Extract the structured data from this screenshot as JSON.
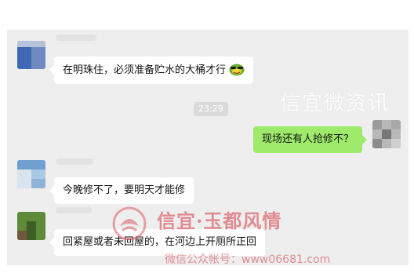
{
  "chat": {
    "messages": [
      {
        "side": "left",
        "text": "在明珠住，必须准备贮水的大桶才行",
        "emoji": "sunglasses-frog-emoji"
      },
      {
        "side": "right",
        "text": "现场还有人抢修不？"
      },
      {
        "side": "left",
        "text": "今晚修不了，要明天才能修"
      },
      {
        "side": "left",
        "text": "回紧屋或者未回屋的，在河边上开厕所正回"
      }
    ],
    "timestamp": "23:29"
  },
  "watermark": {
    "top_text": "信宜微资讯",
    "brand": "信宜·玉都风情",
    "account": "微信公众帐号：www06681.com"
  },
  "colors": {
    "chat_background": "#eeeeee",
    "incoming_bubble": "#ffffff",
    "outgoing_bubble": "#9eea6a",
    "watermark_red": "#d63c46"
  }
}
